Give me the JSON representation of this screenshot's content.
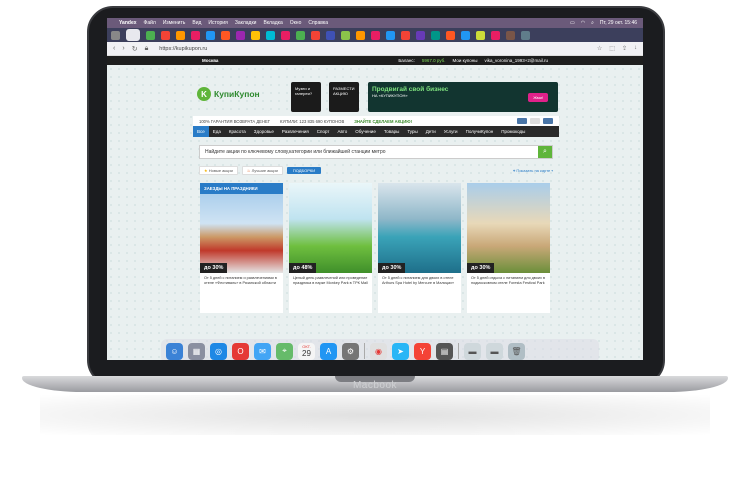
{
  "menubar": {
    "items": [
      "Yandex",
      "Файл",
      "Изменить",
      "Вид",
      "История",
      "Закладки",
      "Вкладка",
      "Окно",
      "Справка"
    ],
    "clock": "Пт, 29 окт. 15:46"
  },
  "address": {
    "url": "https://kupikupon.ru"
  },
  "site": {
    "city": "Москва",
    "balance_label": "Баланс:",
    "balance_value": "5967.0 руб.",
    "my_coupons": "Мои купоны",
    "user_email": "vika_voronina_1993+2@mail.ru"
  },
  "logo": {
    "text": "КупиКупон",
    "mark": "K"
  },
  "promos": {
    "p1": "Музеи и галереи?",
    "p2": "РАЗМЕСТИ АКЦИЮ",
    "p3_big": "Продвигай свой бизнес",
    "p3_small": "НА «КУПИКУПОН»",
    "p3_btn": "Жми!"
  },
  "infobar": {
    "guarantee": "100% ГАРАНТИЯ ВОЗВРАТА ДЕНЕГ",
    "bought": "КУПИЛИ: 123 835 690 КУПОНОВ",
    "deal": "ЗНАЙТЕ СДЕЛАЕМ АКЦИЮ!"
  },
  "categories": [
    "Все",
    "Еда",
    "Красота",
    "Здоровье",
    "Развлечения",
    "Спорт",
    "Авто",
    "Обучение",
    "Товары",
    "Туры",
    "Дети",
    "Услуги",
    "ПолучиКупон",
    "Промокоды"
  ],
  "search": {
    "placeholder": "Найдите акции по ключевому слову,категории или ближайшей станции метро"
  },
  "filters": {
    "new": "Новые акции",
    "best": "Лучшие акции",
    "pick": "ПОДБОРКИ",
    "map": "Показать на карте"
  },
  "cards": [
    {
      "tag": "ЗАЕЗДЫ НА ПРАЗДНИКИ",
      "discount": "30%",
      "desc": "От 5 дней с питанием и развлечениями в отеле «Фестиваль» в Рязанской области"
    },
    {
      "discount": "48%",
      "desc": "Целый день развлечений или проведение праздника в парке Monkey Park в ТРК Mall"
    },
    {
      "discount": "30%",
      "desc": "От 5 дней с питанием для двоих в отеле Arthurs Spa Hotel by Mercure в Малицах»"
    },
    {
      "discount": "30%",
      "desc": "От 5 дней отдыха с питанием для двоих в подмосковном отеле Foresta Festival Park"
    }
  ],
  "laptop_brand": "Macbook",
  "dock_date": {
    "month": "ОКТ.",
    "day": "29"
  }
}
